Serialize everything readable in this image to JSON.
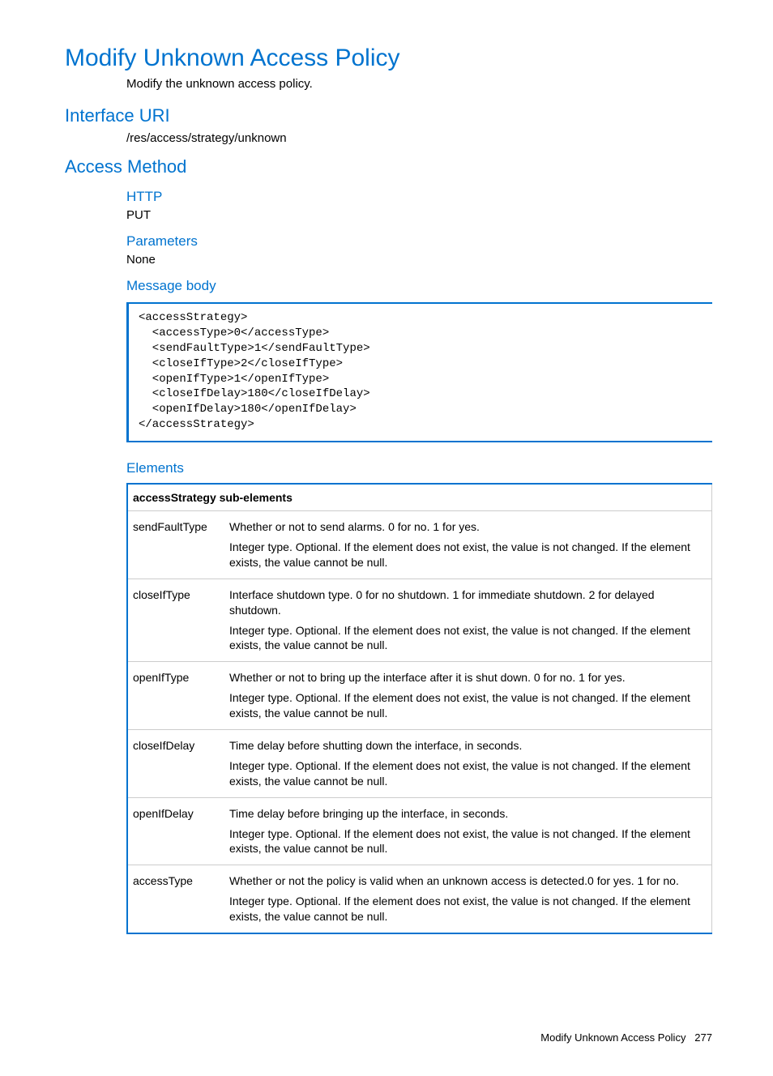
{
  "title": "Modify Unknown Access Policy",
  "intro": "Modify the unknown access policy.",
  "sections": {
    "interface_uri": {
      "heading": "Interface URI",
      "value": "/res/access/strategy/unknown"
    },
    "access_method": {
      "heading": "Access Method",
      "http": {
        "heading": "HTTP",
        "value": "PUT"
      },
      "parameters": {
        "heading": "Parameters",
        "value": "None"
      },
      "message_body": {
        "heading": "Message body",
        "code": "<accessStrategy>\n  <accessType>0</accessType>\n  <sendFaultType>1</sendFaultType>\n  <closeIfType>2</closeIfType>\n  <openIfType>1</openIfType>\n  <closeIfDelay>180</closeIfDelay>\n  <openIfDelay>180</openIfDelay>\n</accessStrategy>"
      },
      "elements": {
        "heading": "Elements",
        "table_header": "accessStrategy sub-elements",
        "optional_note": "Integer type. Optional. If the element does not exist, the value is not changed. If the element exists, the value cannot be null.",
        "rows": [
          {
            "name": "sendFaultType",
            "desc": "Whether or not to send alarms. 0 for no. 1 for yes."
          },
          {
            "name": "closeIfType",
            "desc": "Interface shutdown type. 0 for no shutdown. 1 for immediate shutdown. 2 for delayed shutdown."
          },
          {
            "name": "openIfType",
            "desc": "Whether or not to bring up the interface after it is shut down. 0 for no. 1 for yes."
          },
          {
            "name": "closeIfDelay",
            "desc": "Time delay before shutting down the interface, in seconds."
          },
          {
            "name": "openIfDelay",
            "desc": "Time delay before bringing up the interface, in seconds."
          },
          {
            "name": "accessType",
            "desc": "Whether or not the policy is valid when an unknown access is detected.0 for yes. 1 for no."
          }
        ]
      }
    }
  },
  "footer": {
    "label": "Modify Unknown Access Policy",
    "page": "277"
  }
}
